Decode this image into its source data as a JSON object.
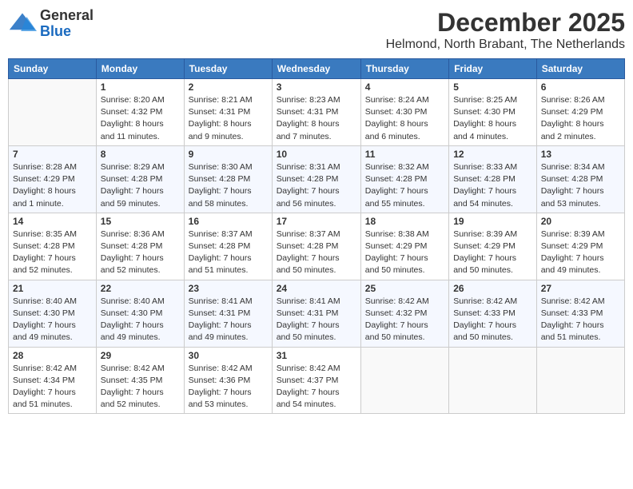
{
  "logo": {
    "general": "General",
    "blue": "Blue"
  },
  "header": {
    "month": "December 2025",
    "location": "Helmond, North Brabant, The Netherlands"
  },
  "weekdays": [
    "Sunday",
    "Monday",
    "Tuesday",
    "Wednesday",
    "Thursday",
    "Friday",
    "Saturday"
  ],
  "weeks": [
    [
      {
        "day": "",
        "info": ""
      },
      {
        "day": "1",
        "info": "Sunrise: 8:20 AM\nSunset: 4:32 PM\nDaylight: 8 hours\nand 11 minutes."
      },
      {
        "day": "2",
        "info": "Sunrise: 8:21 AM\nSunset: 4:31 PM\nDaylight: 8 hours\nand 9 minutes."
      },
      {
        "day": "3",
        "info": "Sunrise: 8:23 AM\nSunset: 4:31 PM\nDaylight: 8 hours\nand 7 minutes."
      },
      {
        "day": "4",
        "info": "Sunrise: 8:24 AM\nSunset: 4:30 PM\nDaylight: 8 hours\nand 6 minutes."
      },
      {
        "day": "5",
        "info": "Sunrise: 8:25 AM\nSunset: 4:30 PM\nDaylight: 8 hours\nand 4 minutes."
      },
      {
        "day": "6",
        "info": "Sunrise: 8:26 AM\nSunset: 4:29 PM\nDaylight: 8 hours\nand 2 minutes."
      }
    ],
    [
      {
        "day": "7",
        "info": "Sunrise: 8:28 AM\nSunset: 4:29 PM\nDaylight: 8 hours\nand 1 minute."
      },
      {
        "day": "8",
        "info": "Sunrise: 8:29 AM\nSunset: 4:28 PM\nDaylight: 7 hours\nand 59 minutes."
      },
      {
        "day": "9",
        "info": "Sunrise: 8:30 AM\nSunset: 4:28 PM\nDaylight: 7 hours\nand 58 minutes."
      },
      {
        "day": "10",
        "info": "Sunrise: 8:31 AM\nSunset: 4:28 PM\nDaylight: 7 hours\nand 56 minutes."
      },
      {
        "day": "11",
        "info": "Sunrise: 8:32 AM\nSunset: 4:28 PM\nDaylight: 7 hours\nand 55 minutes."
      },
      {
        "day": "12",
        "info": "Sunrise: 8:33 AM\nSunset: 4:28 PM\nDaylight: 7 hours\nand 54 minutes."
      },
      {
        "day": "13",
        "info": "Sunrise: 8:34 AM\nSunset: 4:28 PM\nDaylight: 7 hours\nand 53 minutes."
      }
    ],
    [
      {
        "day": "14",
        "info": "Sunrise: 8:35 AM\nSunset: 4:28 PM\nDaylight: 7 hours\nand 52 minutes."
      },
      {
        "day": "15",
        "info": "Sunrise: 8:36 AM\nSunset: 4:28 PM\nDaylight: 7 hours\nand 52 minutes."
      },
      {
        "day": "16",
        "info": "Sunrise: 8:37 AM\nSunset: 4:28 PM\nDaylight: 7 hours\nand 51 minutes."
      },
      {
        "day": "17",
        "info": "Sunrise: 8:37 AM\nSunset: 4:28 PM\nDaylight: 7 hours\nand 50 minutes."
      },
      {
        "day": "18",
        "info": "Sunrise: 8:38 AM\nSunset: 4:29 PM\nDaylight: 7 hours\nand 50 minutes."
      },
      {
        "day": "19",
        "info": "Sunrise: 8:39 AM\nSunset: 4:29 PM\nDaylight: 7 hours\nand 50 minutes."
      },
      {
        "day": "20",
        "info": "Sunrise: 8:39 AM\nSunset: 4:29 PM\nDaylight: 7 hours\nand 49 minutes."
      }
    ],
    [
      {
        "day": "21",
        "info": "Sunrise: 8:40 AM\nSunset: 4:30 PM\nDaylight: 7 hours\nand 49 minutes."
      },
      {
        "day": "22",
        "info": "Sunrise: 8:40 AM\nSunset: 4:30 PM\nDaylight: 7 hours\nand 49 minutes."
      },
      {
        "day": "23",
        "info": "Sunrise: 8:41 AM\nSunset: 4:31 PM\nDaylight: 7 hours\nand 49 minutes."
      },
      {
        "day": "24",
        "info": "Sunrise: 8:41 AM\nSunset: 4:31 PM\nDaylight: 7 hours\nand 50 minutes."
      },
      {
        "day": "25",
        "info": "Sunrise: 8:42 AM\nSunset: 4:32 PM\nDaylight: 7 hours\nand 50 minutes."
      },
      {
        "day": "26",
        "info": "Sunrise: 8:42 AM\nSunset: 4:33 PM\nDaylight: 7 hours\nand 50 minutes."
      },
      {
        "day": "27",
        "info": "Sunrise: 8:42 AM\nSunset: 4:33 PM\nDaylight: 7 hours\nand 51 minutes."
      }
    ],
    [
      {
        "day": "28",
        "info": "Sunrise: 8:42 AM\nSunset: 4:34 PM\nDaylight: 7 hours\nand 51 minutes."
      },
      {
        "day": "29",
        "info": "Sunrise: 8:42 AM\nSunset: 4:35 PM\nDaylight: 7 hours\nand 52 minutes."
      },
      {
        "day": "30",
        "info": "Sunrise: 8:42 AM\nSunset: 4:36 PM\nDaylight: 7 hours\nand 53 minutes."
      },
      {
        "day": "31",
        "info": "Sunrise: 8:42 AM\nSunset: 4:37 PM\nDaylight: 7 hours\nand 54 minutes."
      },
      {
        "day": "",
        "info": ""
      },
      {
        "day": "",
        "info": ""
      },
      {
        "day": "",
        "info": ""
      }
    ]
  ]
}
